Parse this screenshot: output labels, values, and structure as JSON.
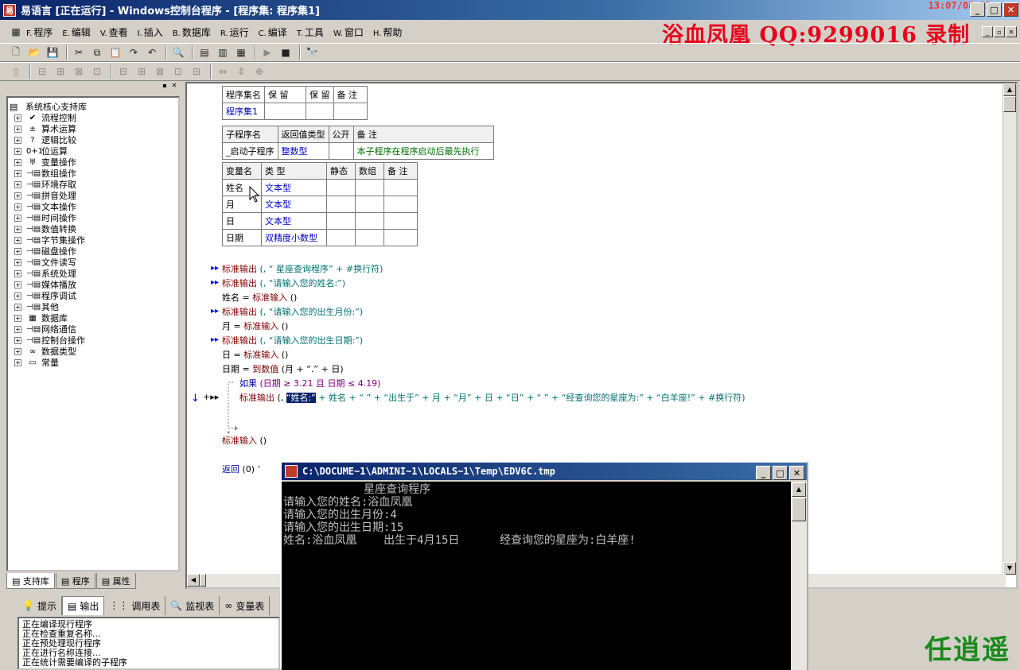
{
  "titlebar": {
    "title": "易语言 [正在运行] - Windows控制台程序 - [程序集: 程序集1]",
    "clock": "13:07/08:22"
  },
  "menu": [
    {
      "key": "F.",
      "label": "程序"
    },
    {
      "key": "E.",
      "label": "编辑"
    },
    {
      "key": "V.",
      "label": "查看"
    },
    {
      "key": "I.",
      "label": "插入"
    },
    {
      "key": "B.",
      "label": "数据库"
    },
    {
      "key": "R.",
      "label": "运行"
    },
    {
      "key": "C.",
      "label": "编译"
    },
    {
      "key": "T.",
      "label": "工具"
    },
    {
      "key": "W.",
      "label": "窗口"
    },
    {
      "key": "H.",
      "label": "帮助"
    }
  ],
  "watermark": "浴血凤凰 QQ:9299016  录制",
  "tree": {
    "root": "系统核心支持库",
    "items": [
      "流程控制",
      "算术运算",
      "逻辑比较",
      "位运算",
      "变量操作",
      "数组操作",
      "环境存取",
      "拼音处理",
      "文本操作",
      "时间操作",
      "数值转换",
      "字节集操作",
      "磁盘操作",
      "文件读写",
      "系统处理",
      "媒体播放",
      "程序调试",
      "其他",
      "数据库",
      "网络通信",
      "控制台操作",
      "数据类型",
      "常量"
    ]
  },
  "left_tabs": [
    "支持库",
    "程序",
    "属性"
  ],
  "assembly_table": {
    "headers": [
      "程序集名",
      "保 留",
      "保 留",
      "备 注"
    ],
    "row": [
      "程序集1",
      "",
      "",
      ""
    ]
  },
  "sub_table": {
    "headers": [
      "子程序名",
      "返回值类型",
      "公开",
      "备 注"
    ],
    "row": [
      "_启动子程序",
      "整数型",
      "",
      "本子程序在程序启动后最先执行"
    ]
  },
  "var_table": {
    "headers": [
      "变量名",
      "类 型",
      "静态",
      "数组",
      "备 注"
    ],
    "rows": [
      [
        "姓名",
        "文本型",
        "",
        "",
        ""
      ],
      [
        "月",
        "文本型",
        "",
        "",
        ""
      ],
      [
        "日",
        "文本型",
        "",
        "",
        ""
      ],
      [
        "日期",
        "双精度小数型",
        "",
        "",
        ""
      ]
    ]
  },
  "code": {
    "l1": {
      "fn": "标准输出",
      "rest": " (, “            星座查询程序” + #换行符)"
    },
    "l2": {
      "fn": "标准输出",
      "rest": " (, “请输入您的姓名:”)"
    },
    "l3": {
      "a": "姓名 = ",
      "fn": "标准输入",
      "rest": " ()"
    },
    "l4": {
      "fn": "标准输出",
      "rest": " (, “请输入您的出生月份:”)"
    },
    "l5": {
      "a": "月 = ",
      "fn": "标准输入",
      "rest": " ()"
    },
    "l6": {
      "fn": "标准输出",
      "rest": " (, “请输入您的出生日期:”)"
    },
    "l7": {
      "a": "日 = ",
      "fn": "标准输入",
      "rest": " ()"
    },
    "l8": {
      "a": "日期 = ",
      "fn": "到数值",
      "rest": " (月 + “.” + 日)"
    },
    "l9": {
      "kw": "如果",
      "rest": " (日期 ≥ 3.21 且 日期 ≤ 4.19)"
    },
    "l10": {
      "fn": "标准输出",
      "pre": " (, ",
      "hl": "“姓名:”",
      "rest": " + 姓名 + “   ” + “出生于” + 月 + “月” + 日 + “日” + “     ” + “经查询您的星座为:” + “白羊座!” + #换行符)"
    },
    "l11": {
      "fn": "标准输入",
      "rest": " ()"
    },
    "l12": {
      "kw": "返回",
      "rest": " (0)  ’"
    }
  },
  "bottom_tabs": [
    "提示",
    "输出",
    "调用表",
    "监视表",
    "变量表"
  ],
  "output_lines": [
    "正在编译现行程序",
    "正在检查重复名称...",
    "正在预处理现行程序",
    "正在进行名称连接...",
    "正在统计需要编译的子程序"
  ],
  "console": {
    "title": "C:\\DOCUME~1\\ADMINI~1\\LOCALS~1\\Temp\\EDV6C.tmp",
    "lines": [
      "            星座查询程序",
      "请输入您的姓名:浴血凤凰",
      "请输入您的出生月份:4",
      "请输入您的出生日期:15",
      "姓名:浴血凤凰    出生于4月15日      经查询您的星座为:白羊座!"
    ]
  },
  "signature": "任逍遥"
}
